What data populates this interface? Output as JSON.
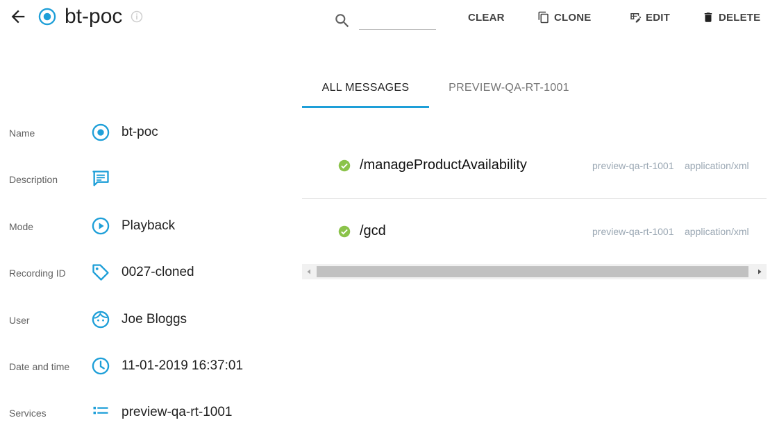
{
  "header": {
    "title": "bt-poc",
    "search": {
      "value": "",
      "placeholder": ""
    },
    "actions": {
      "clear": "CLEAR",
      "clone": "CLONE",
      "edit": "EDIT",
      "delete": "DELETE"
    }
  },
  "tabs": [
    {
      "label": "ALL MESSAGES",
      "active": true
    },
    {
      "label": "PREVIEW-QA-RT-1001",
      "active": false
    }
  ],
  "details": [
    {
      "label": "Name",
      "icon": "recording-icon",
      "value": "bt-poc"
    },
    {
      "label": "Description",
      "icon": "comment-icon",
      "value": ""
    },
    {
      "label": "Mode",
      "icon": "play-circle-icon",
      "value": "Playback"
    },
    {
      "label": "Recording ID",
      "icon": "tag-icon",
      "value": "0027-cloned"
    },
    {
      "label": "User",
      "icon": "face-icon",
      "value": "Joe Bloggs"
    },
    {
      "label": "Date and time",
      "icon": "clock-icon",
      "value": "11-01-2019 16:37:01"
    },
    {
      "label": "Services",
      "icon": "list-icon",
      "value": "preview-qa-rt-1001"
    }
  ],
  "messages": [
    {
      "path": "/manageProductAvailability",
      "service": "preview-qa-rt-1001",
      "content_type": "application/xml",
      "status": "success"
    },
    {
      "path": "/gcd",
      "service": "preview-qa-rt-1001",
      "content_type": "application/xml",
      "status": "success"
    }
  ],
  "colors": {
    "accent": "#1e9fd8",
    "success": "#8bc34a",
    "muted": "#9aa7b3"
  }
}
